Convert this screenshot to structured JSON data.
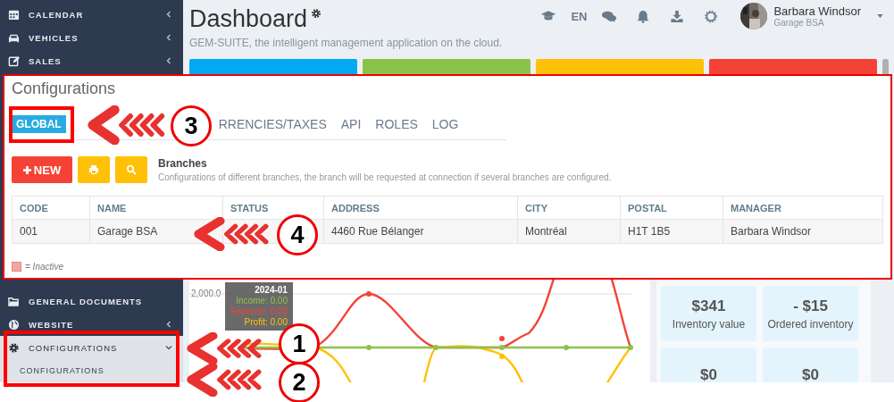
{
  "sidebar": {
    "top_items": [
      {
        "label": "CALENDAR",
        "expanded": false,
        "selected": false
      },
      {
        "label": "VEHICLES",
        "expanded": false,
        "selected": false
      },
      {
        "label": "SALES",
        "expanded": false,
        "selected": false
      }
    ],
    "bottom_items": [
      {
        "label": "GENERAL DOCUMENTS",
        "selected": false
      },
      {
        "label": "WEBSITE",
        "expanded": false,
        "selected": false
      },
      {
        "label": "CONFIGURATIONS",
        "expanded": true,
        "selected": true,
        "children": [
          {
            "label": "CONFIGURATIONS",
            "selected": true
          }
        ]
      }
    ]
  },
  "header": {
    "title": "Dashboard",
    "subtitle": "GEM-SUITE, the intelligent management application on the cloud.",
    "language": "EN",
    "user": {
      "name": "Barbara Windsor",
      "company": "Garage BSA"
    }
  },
  "tiles": [
    {
      "color": "#03a9f4"
    },
    {
      "color": "#8bc34a"
    },
    {
      "color": "#ffc107"
    },
    {
      "color": "#f44336"
    }
  ],
  "configurations": {
    "title": "Configurations",
    "tabs": [
      {
        "label": "GLOBAL",
        "selected": true
      },
      {
        "label": "RRENCIES/TAXES",
        "selected": false
      },
      {
        "label": "API",
        "selected": false
      },
      {
        "label": "ROLES",
        "selected": false
      },
      {
        "label": "LOG",
        "selected": false
      }
    ],
    "new_button": "NEW",
    "section": {
      "title": "Branches",
      "description": "Configurations of different branches, the branch will be requested at connection if several branches are configured."
    },
    "table": {
      "columns": [
        "CODE",
        "NAME",
        "STATUS",
        "ADDRESS",
        "CITY",
        "POSTAL",
        "MANAGER"
      ],
      "rows": [
        {
          "code": "001",
          "name": "Garage BSA",
          "address": "4460 Rue Bélanger",
          "city": "Montréal",
          "postal": "H1T 1B5",
          "manager": "Barbara Windsor"
        }
      ]
    },
    "legend": "= Inactive"
  },
  "chart": {
    "tick_label": "2,000.0",
    "tooltip": {
      "title": "2024-01",
      "lines": [
        {
          "text": "Income: 0.00",
          "color": "#8bc34a"
        },
        {
          "text": "Expense: 0.00",
          "color": "#f44336"
        },
        {
          "text": "Profit: 0.00",
          "color": "#ffc107"
        }
      ]
    }
  },
  "stats": [
    {
      "value": "$341",
      "label": "Inventory value"
    },
    {
      "value": "- $15",
      "label": "Ordered inventory"
    },
    {
      "value": "$0"
    },
    {
      "value": "$0"
    }
  ],
  "callouts": [
    {
      "number": "1"
    },
    {
      "number": "2"
    },
    {
      "number": "3"
    },
    {
      "number": "4"
    }
  ]
}
